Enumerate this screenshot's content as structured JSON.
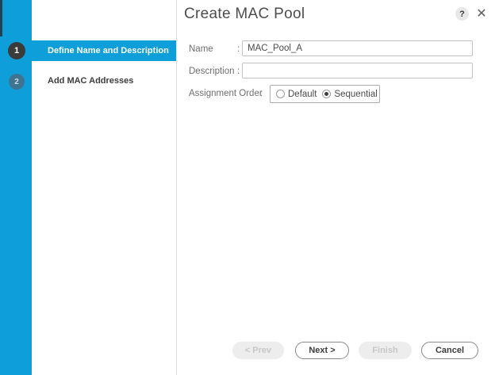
{
  "dialog": {
    "title": "Create MAC Pool",
    "help_glyph": "?",
    "close_glyph": "✕"
  },
  "steps": [
    {
      "number": "1",
      "label": "Define Name and Description",
      "state": "active"
    },
    {
      "number": "2",
      "label": "Add MAC Addresses",
      "state": "upcoming"
    }
  ],
  "form": {
    "name": {
      "label": "Name",
      "colon": ":",
      "value": "MAC_Pool_A"
    },
    "description": {
      "label": "Description",
      "colon": ":",
      "value": ""
    },
    "assignment_order": {
      "label": "Assignment Order",
      "colon": ":",
      "selected": "Sequential",
      "options": [
        {
          "label": "Default",
          "selected": false
        },
        {
          "label": "Sequential",
          "selected": true
        }
      ]
    }
  },
  "footer": {
    "buttons": [
      {
        "label": "< Prev",
        "enabled": false
      },
      {
        "label": "Next >",
        "enabled": true
      },
      {
        "label": "Finish",
        "enabled": false
      },
      {
        "label": "Cancel",
        "enabled": true
      }
    ]
  },
  "colors": {
    "accent_blue": "#0E9FDB",
    "active_step_circle": "#3B3B3B",
    "inactive_step_circle": "#3F7490"
  }
}
